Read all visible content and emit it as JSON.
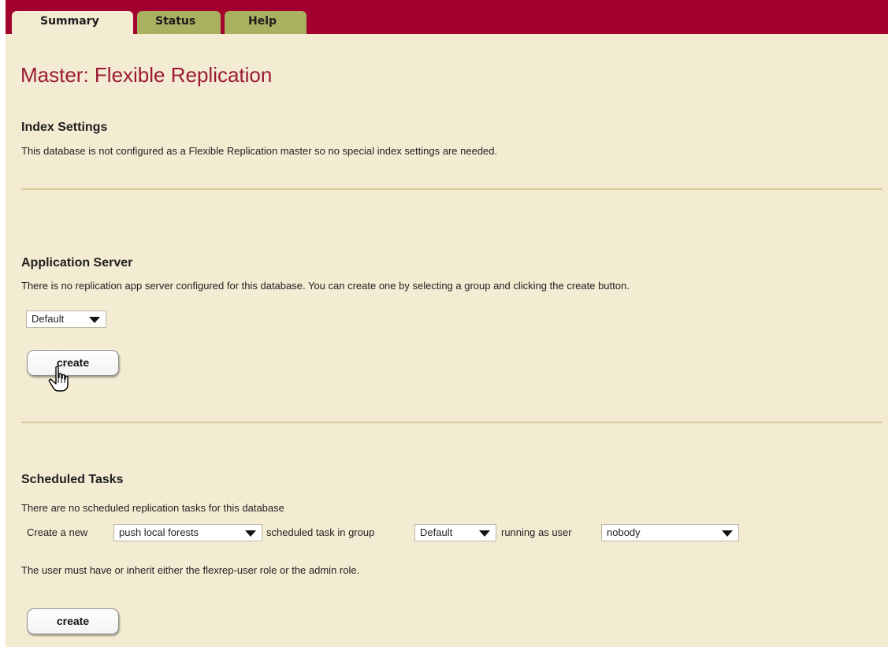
{
  "tabs": [
    {
      "label": "Summary"
    },
    {
      "label": "Status"
    },
    {
      "label": "Help"
    }
  ],
  "page": {
    "title": "Master: Flexible Replication"
  },
  "index_settings": {
    "heading": "Index Settings",
    "text": "This database is not configured as a Flexible Replication master so no special index settings are needed."
  },
  "app_server": {
    "heading": "Application Server",
    "text": "There is no replication app server configured for this database. You can create one by selecting a group and clicking the create button.",
    "group_select": {
      "value": "Default"
    },
    "create_label": "create"
  },
  "scheduled_tasks": {
    "heading": "Scheduled Tasks",
    "text": "There are no scheduled replication tasks for this database",
    "create_prefix": "Create a new",
    "task_select": {
      "value": "push local forests"
    },
    "middle_text": "scheduled task in group",
    "group_select": {
      "value": "Default"
    },
    "user_text": "running as user",
    "user_select": {
      "value": "nobody"
    },
    "note": "The user must have or inherit either the flexrep-user role or the admin role.",
    "create_label": "create"
  },
  "colors": {
    "header": "#a3002f",
    "background": "#f3ebd2",
    "inactive_tab": "#a9b060",
    "title": "#9c1a36"
  },
  "icons": {
    "cursor": "hand-pointer-cursor"
  }
}
